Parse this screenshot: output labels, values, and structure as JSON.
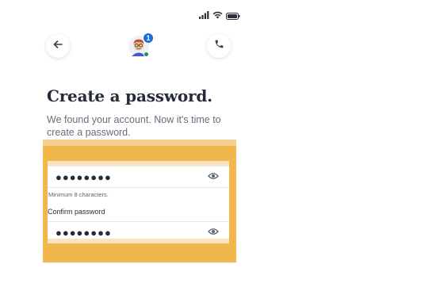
{
  "header": {
    "notification_count": "1",
    "icons": {
      "back": "arrow-left-icon",
      "phone": "phone-icon",
      "avatar": "avatar-icon",
      "signal": "signal-icon",
      "wifi": "wifi-icon",
      "battery": "battery-icon"
    }
  },
  "main": {
    "title": "Create a password.",
    "subtitle": "We found your account. Now it's time to create a password."
  },
  "form": {
    "password_value": "●●●●●●●●",
    "hint": "Minimum 8 characters.",
    "confirm_label": "Confirm password",
    "confirm_value": "●●●●●●●●",
    "toggle_icon": "eye-icon"
  },
  "colors": {
    "highlight": "#f2b74c",
    "badge": "#1a6fd6",
    "online": "#1f8f55",
    "title": "#262b38",
    "subtitle": "#666d7a"
  }
}
